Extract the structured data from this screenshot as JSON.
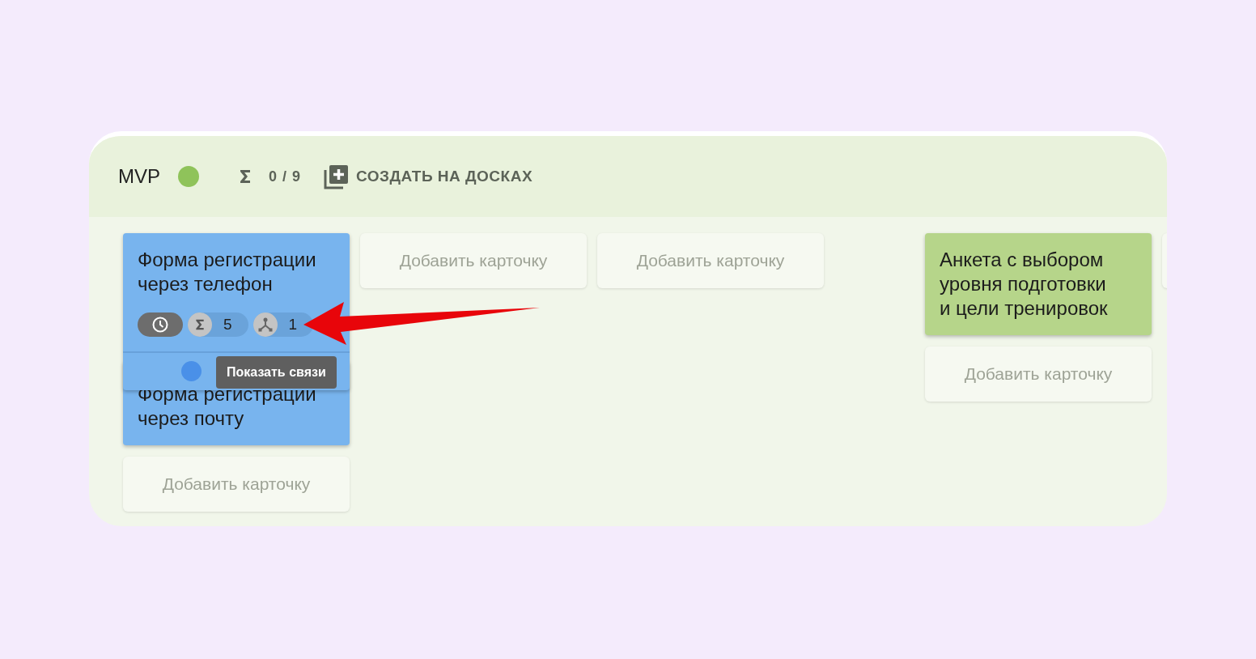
{
  "board": {
    "title": "MVP",
    "status": {
      "color": "#8fc35a"
    },
    "progress": "0 / 9",
    "create_button": "СОЗДАТЬ НА ДОСКАХ"
  },
  "columns": [
    {
      "kind": "list",
      "cards": [
        {
          "title": "Форма регистрации\nчерез телефон",
          "color": "#78b4ee",
          "expanded": true,
          "chips": [
            {
              "kind": "time"
            },
            {
              "kind": "sum",
              "count": "5"
            },
            {
              "kind": "links",
              "count": "1"
            }
          ],
          "dot": {
            "color": "#4a90e8"
          },
          "tooltip": "Показать связи"
        },
        {
          "title": "Форма регистрации\nчерез почту",
          "color": "#78b4ee",
          "expanded": false
        }
      ],
      "add_label": "Добавить карточку"
    },
    {
      "kind": "list",
      "add_label": "Добавить карточку"
    },
    {
      "kind": "list",
      "add_label": "Добавить карточку"
    },
    {
      "kind": "gap"
    },
    {
      "kind": "list",
      "cards": [
        {
          "title": "Анкета с выбором\nуровня подготовки\nи цели тренировок",
          "color": "#b6d58a",
          "expanded": false
        }
      ],
      "add_label": "Добавить карточку"
    },
    {
      "kind": "cut"
    }
  ]
}
